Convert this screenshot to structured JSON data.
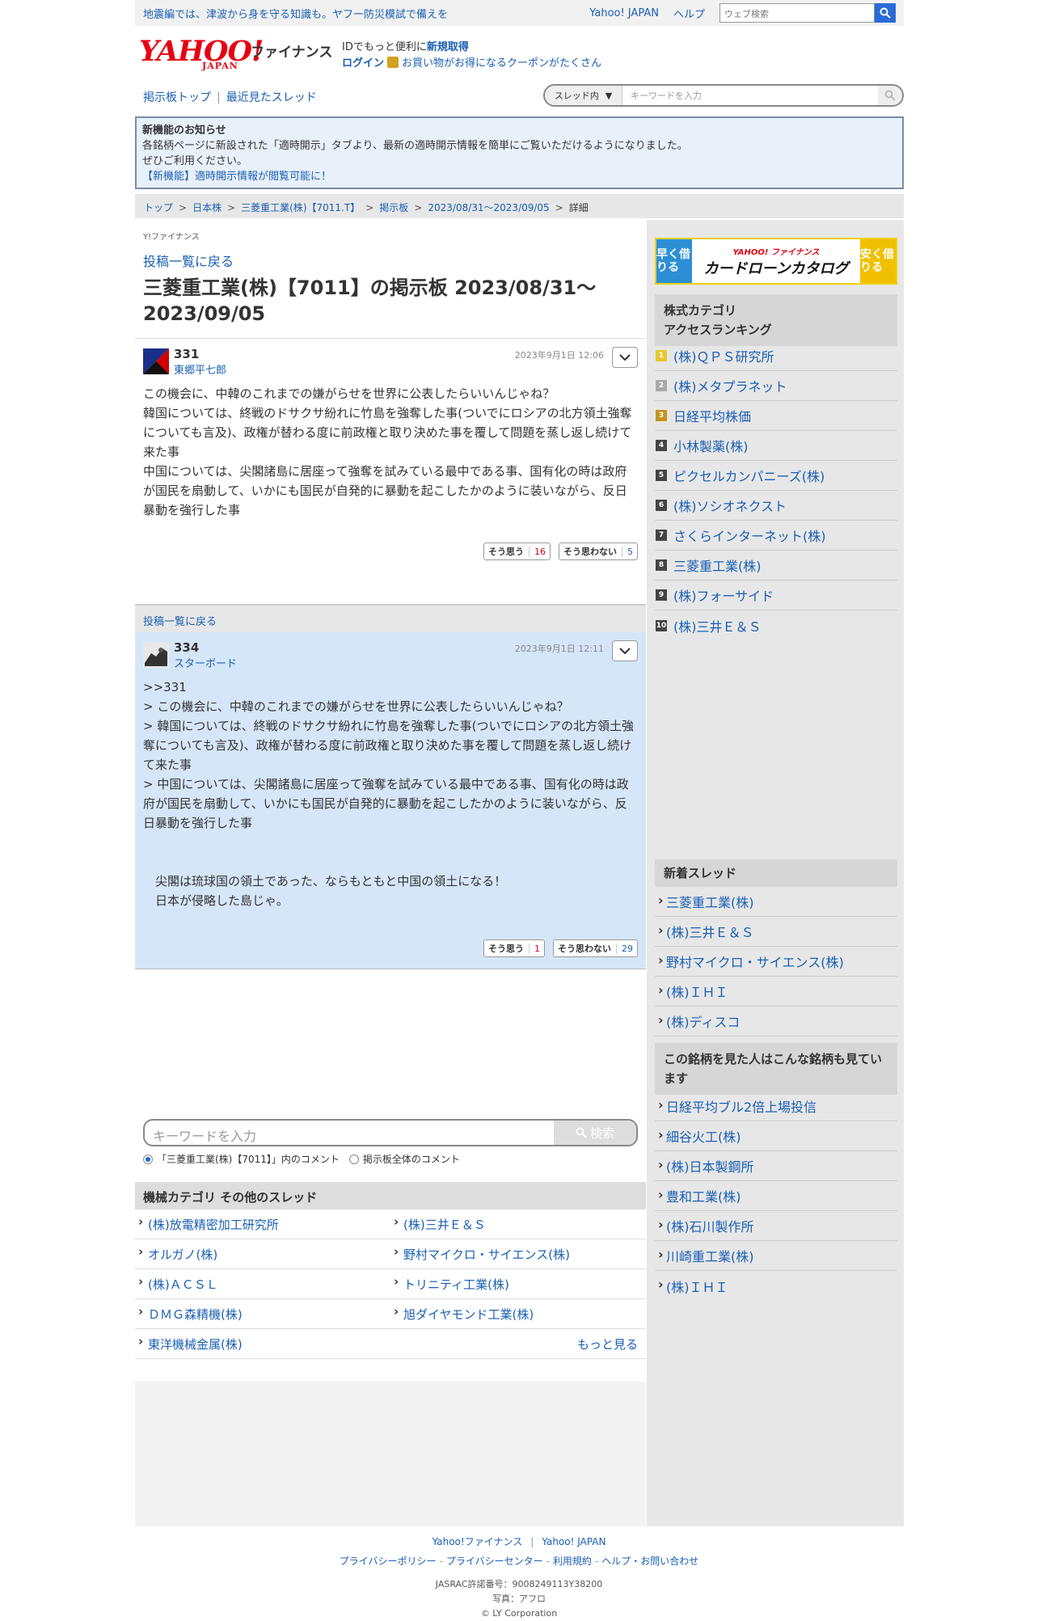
{
  "promo": {
    "message": "地震編では、津波から身を守る知識も。ヤフー防災模試で備えを",
    "links": [
      "Yahoo! JAPAN",
      "ヘルプ"
    ],
    "web_search_placeholder": "ウェブ検索"
  },
  "header": {
    "logo_text": "YAHOO!",
    "logo_sub": "JAPAN",
    "finance_label": "ファイナンス",
    "line1_prefix": "IDでもっと便利に",
    "line1_link": "新規取得",
    "line2_login": "ログイン",
    "line2_coupon": "お買い物がお得になるクーポンがたくさん"
  },
  "nav": {
    "board_top": "掲示板トップ",
    "separator": "|",
    "recent": "最近見たスレッド",
    "scope_label": "スレッド内",
    "keyword_placeholder": "キーワードを入力"
  },
  "notice": {
    "title": "新機能のお知らせ",
    "line1": "各銘柄ページに新設された「適時開示」タブより、最新の適時開示情報を簡単にご覧いただけるようになりました。",
    "line2": "ぜひご利用ください。",
    "link": "【新機能】適時開示情報が閲覧可能に！"
  },
  "breadcrumb": {
    "items": [
      "トップ",
      "日本株",
      "三菱重工業(株)【7011.T】",
      "掲示板",
      "2023/08/31〜2023/09/05"
    ],
    "sep": ">",
    "current": "詳細"
  },
  "main": {
    "yf_label": "Y!ファイナンス",
    "back_link": "投稿一覧に戻る",
    "title": "三菱重工業(株)【7011】の掲示板 2023/08/31〜2023/09/05"
  },
  "posts": [
    {
      "number": "331",
      "user": "東郷平七郎",
      "date": "2023年9月1日 12:06",
      "body": "この機会に、中韓のこれまでの嫌がらせを世界に公表したらいいんじゃね？\n韓国については、終戦のドサクサ紛れに竹島を強奪した事(ついでにロシアの北方領土強奪についても言及)、政権が替わる度に前政権と取り決めた事を覆して問題を蒸し返し続けて来た事\n中国については、尖閣諸島に居座って強奪を試みている最中である事、国有化の時は政府が国民を扇動して、いかにも国民が自発的に暴動を起こしたかのように装いながら、反日暴動を強行した事",
      "agree_label": "そう思う",
      "agree_count": "16",
      "disagree_label": "そう思わない",
      "disagree_count": "5"
    },
    {
      "number": "334",
      "user": "スターボード",
      "date": "2023年9月1日 12:11",
      "body": ">>331\n> この機会に、中韓のこれまでの嫌がらせを世界に公表したらいいんじゃね？\n> 韓国については、終戦のドサクサ紛れに竹島を強奪した事(ついでにロシアの北方領土強奪についても言及)、政権が替わる度に前政権と取り決めた事を覆して問題を蒸し返し続けて来た事\n> 中国については、尖閣諸島に居座って強奪を試みている最中である事、国有化の時は政府が国民を扇動して、いかにも国民が自発的に暴動を起こしたかのように装いながら、反日暴動を強行した事\n\n\n　尖閣は琉球国の領土であった、ならもともと中国の領土になる！\n　日本が侵略した島じゃ。",
      "agree_label": "そう思う",
      "agree_count": "1",
      "disagree_label": "そう思わない",
      "disagree_count": "29"
    }
  ],
  "bottom_search": {
    "placeholder": "キーワードを入力",
    "button": "検索",
    "radio1": "「三菱重工業(株)【7011】」内のコメント",
    "radio2": "掲示板全体のコメント"
  },
  "category": {
    "header": "機械カテゴリ その他のスレッド",
    "rows": [
      [
        "(株)放電精密加工研究所",
        "(株)三井Ｅ＆Ｓ"
      ],
      [
        "オルガノ(株)",
        "野村マイクロ・サイエンス(株)"
      ],
      [
        "(株)ＡＣＳＬ",
        "トリニティ工業(株)"
      ],
      [
        "ＤＭＧ森精機(株)",
        "旭ダイヤモンド工業(株)"
      ]
    ],
    "last_item": "東洋機械金属(株)",
    "more": "もっと見る"
  },
  "side": {
    "ad": {
      "left": "早く借りる",
      "brand": "YAHOO! ファイナンス",
      "main": "カードローンカタログ",
      "right": "安く借りる"
    },
    "ranking_header": "株式カテゴリ\nアクセスランキング",
    "ranking": [
      "(株)ＱＰＳ研究所",
      "(株)メタプラネット",
      "日経平均株価",
      "小林製薬(株)",
      "ピクセルカンパニーズ(株)",
      "(株)ソシオネクスト",
      "さくらインターネット(株)",
      "三菱重工業(株)",
      "(株)フォーサイド",
      "(株)三井Ｅ＆Ｓ"
    ],
    "new_header": "新着スレッド",
    "new_threads": [
      "三菱重工業(株)",
      "(株)三井Ｅ＆Ｓ",
      "野村マイクロ・サイエンス(株)",
      "(株)ＩＨＩ",
      "(株)ディスコ"
    ],
    "also_header": "この銘柄を見た人はこんな銘柄も見ています",
    "also": [
      "日経平均ブル2倍上場投信",
      "細谷火工(株)",
      "(株)日本製鋼所",
      "豊和工業(株)",
      "(株)石川製作所",
      "川崎重工業(株)",
      "(株)ＩＨＩ"
    ]
  },
  "footer": {
    "row1": [
      "Yahoo!ファイナンス",
      "Yahoo! JAPAN"
    ],
    "row2": [
      "プライバシーポリシー",
      "プライバシーセンター",
      "利用規約",
      "ヘルプ・お問い合わせ"
    ],
    "jasrac": "JASRAC許諾番号：9008249113Y38200",
    "photo": "写真：アフロ",
    "copyright": "© LY Corporation"
  }
}
